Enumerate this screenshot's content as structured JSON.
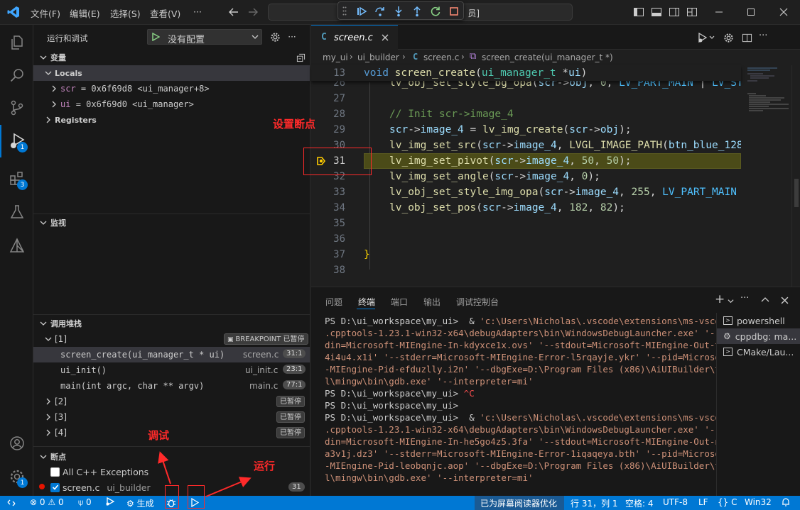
{
  "menu": [
    "文件(F)",
    "编辑(E)",
    "选择(S)",
    "查看(V)",
    "···"
  ],
  "command_center": "员]",
  "icons": {
    "vscode": "vscode-logo-icon",
    "back": "arrow-left-icon",
    "forward": "arrow-right-icon",
    "continue": "continue-icon",
    "step_over": "step-over-icon",
    "step_into": "step-into-icon",
    "step_out": "step-out-icon",
    "restart": "restart-icon",
    "stop": "stop-icon"
  },
  "activity": {
    "debug_badge": "1",
    "ext_badge": "3",
    "account_badge": "1"
  },
  "sidebar": {
    "title": "运行和调试",
    "config": "没有配置",
    "variables_header": "变量",
    "locals": "Locals",
    "vars": [
      {
        "name": "scr",
        "value": "= 0x6f69d8 <ui_manager+8>"
      },
      {
        "name": "ui",
        "value": "= 0x6f69d0 <ui_manager>"
      }
    ],
    "registers": "Registers",
    "watch_header": "监视",
    "callstack_header": "调用堆栈",
    "threads": [
      {
        "name": "[1]",
        "breakpoint": "BREAKPOINT",
        "status": "已暂停"
      },
      {
        "name": "[2]",
        "status": "已暂停"
      },
      {
        "name": "[3]",
        "status": "已暂停"
      },
      {
        "name": "[4]",
        "status": "已暂停"
      }
    ],
    "frames": [
      {
        "fn": "screen_create(ui_manager_t * ui)",
        "file": "screen.c",
        "pos": "31:1"
      },
      {
        "fn": "ui_init()",
        "file": "ui_init.c",
        "pos": "23:1"
      },
      {
        "fn": "main(int argc, char ** argv)",
        "file": "main.c",
        "pos": "77:1"
      }
    ],
    "breakpoints_header": "断点",
    "all_cpp": "All C++ Exceptions",
    "bp_file": "screen.c",
    "bp_folder": "ui_builder",
    "bp_line": "31"
  },
  "editor": {
    "tab": "screen.c",
    "breadcrumb": [
      "my_ui",
      "ui_builder",
      "screen.c",
      "screen_create(ui_manager_t *)"
    ],
    "sticky_ln": "13",
    "line_numbers": [
      "26",
      "27",
      "28",
      "29",
      "30",
      "31",
      "32",
      "33",
      "34",
      "35",
      "36",
      "37",
      "38"
    ]
  },
  "panel": {
    "tabs": [
      "问题",
      "终端",
      "端口",
      "输出",
      "调试控制台"
    ],
    "terminals": [
      "powershell",
      "cppdbg: ma...",
      "CMake/Lau..."
    ]
  },
  "status": {
    "errors": "0",
    "warnings": "0",
    "ports": "0",
    "build": "生成",
    "screen_reader": "已为屏幕阅读器优化",
    "position": "行 31，列 1",
    "spaces": "空格: 4",
    "encoding": "UTF-8",
    "eol": "LF",
    "lang": "C",
    "platform": "Win32"
  },
  "annotations": {
    "breakpoint": "设置断点",
    "debug": "调试",
    "run": "运行"
  }
}
